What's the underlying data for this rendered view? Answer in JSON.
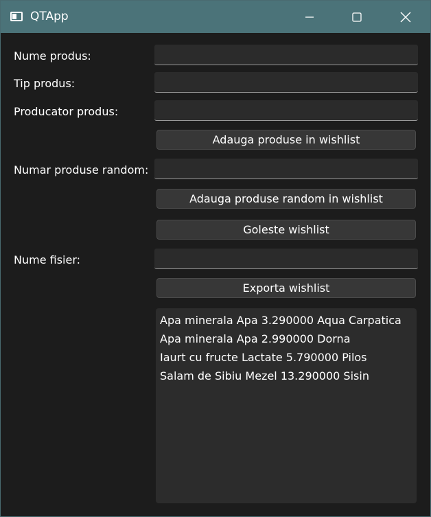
{
  "window": {
    "title": "QTApp",
    "icon": "app-window-icon",
    "controls": [
      "minimize-icon",
      "maximize-icon",
      "close-icon"
    ]
  },
  "form": {
    "nume_produs_label": "Nume produs:",
    "nume_produs_value": "",
    "tip_produs_label": "Tip produs:",
    "tip_produs_value": "",
    "producator_label": "Producator produs:",
    "producator_value": "",
    "add_button": "Adauga produse in wishlist",
    "random_label": "Numar produse random:",
    "random_value": "",
    "add_random_button": "Adauga produse random in wishlist",
    "clear_button": "Goleste wishlist",
    "file_label": "Nume fisier:",
    "file_value": "",
    "export_button": "Exporta wishlist"
  },
  "wishlist": {
    "items": [
      "Apa minerala Apa 3.290000 Aqua Carpatica",
      "Apa minerala Apa 2.990000 Dorna",
      "Iaurt cu fructe Lactate 5.790000 Pilos",
      "Salam de Sibiu Mezel 13.290000 Sisin"
    ]
  },
  "colors": {
    "titlebar": "#4b7379",
    "background": "#1c1c1c",
    "field": "#2b2b2b",
    "button": "#373737"
  }
}
